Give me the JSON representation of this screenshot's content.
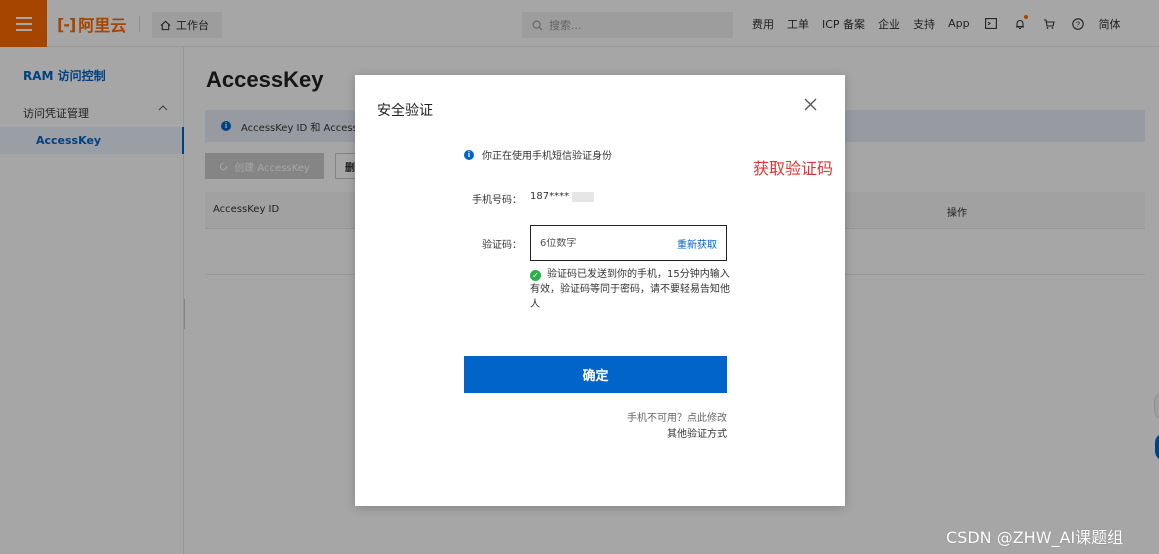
{
  "topbar": {
    "logo_text": "阿里云",
    "logo_mark": "[-]",
    "workbench_label": "工作台",
    "search_placeholder": "搜索...",
    "nav": {
      "fees": "费用",
      "ticket": "工单",
      "icp": "ICP 备案",
      "enterprise": "企业",
      "support": "支持",
      "app": "App",
      "lang": "简体"
    },
    "icons": [
      "terminal-icon",
      "bell-icon",
      "cart-icon",
      "help-icon"
    ],
    "accent_color": "#ff6a00"
  },
  "sidebar": {
    "title": "RAM 访问控制",
    "group_label": "访问凭证管理",
    "active_item": "AccessKey"
  },
  "main": {
    "title": "AccessKey",
    "notice_text": "AccessKey ID 和 AccessK",
    "create_button": "创建 AccessKey",
    "second_button": "删",
    "table": {
      "columns": [
        "AccessKey ID",
        "操作"
      ]
    }
  },
  "modal": {
    "title": "安全验证",
    "hint": "你正在使用手机短信验证身份",
    "phone_label": "手机号码：",
    "phone_value": "187****",
    "code_label": "验证码：",
    "code_placeholder": "6位数字",
    "resend_label": "重新获取",
    "success_message": "验证码已发送到你的手机，15分钟内输入有效，验证码等同于密码，请不要轻易告知他人",
    "confirm_label": "确定",
    "link_phone_unavailable": "手机不可用？点此修改",
    "link_other_methods": "其他验证方式",
    "primary_color": "#0064c8"
  },
  "annotation_text": "获取验证码",
  "watermark": "CSDN @ZHW_AI课题组"
}
